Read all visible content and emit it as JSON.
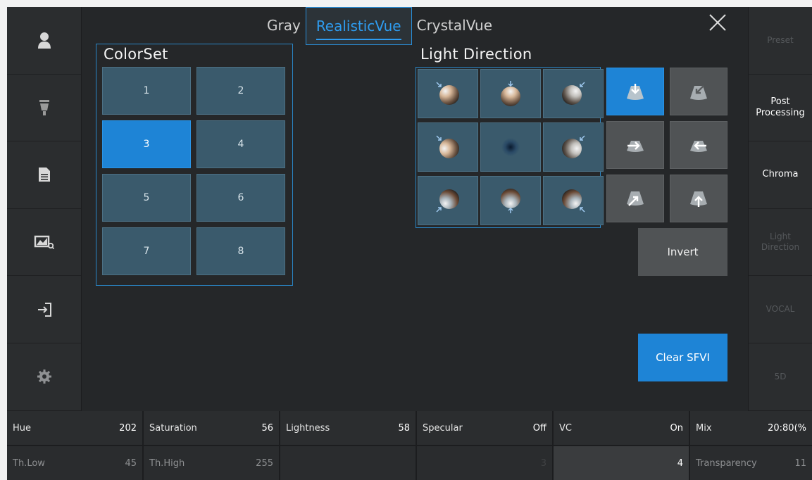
{
  "tabs": [
    {
      "label": "Gray",
      "active": false
    },
    {
      "label": "RealisticVue",
      "active": true
    },
    {
      "label": "CrystalVue",
      "active": false
    }
  ],
  "left_sidebar": [
    "user-icon",
    "probe-icon",
    "report-icon",
    "image-search-icon",
    "exit-icon",
    "gear-icon"
  ],
  "right_sidebar": [
    {
      "label": "Preset",
      "enabled": false
    },
    {
      "label": "Post\nProcessing",
      "enabled": true
    },
    {
      "label": "Chroma",
      "enabled": true
    },
    {
      "label": "Light\nDirection",
      "enabled": false
    },
    {
      "label": "VOCAL",
      "enabled": false
    },
    {
      "label": "5D",
      "enabled": false
    }
  ],
  "colorset": {
    "title": "ColorSet",
    "buttons": [
      "1",
      "2",
      "3",
      "4",
      "5",
      "6",
      "7",
      "8"
    ],
    "selected": "3"
  },
  "light_direction": {
    "title": "Light Direction"
  },
  "actions": {
    "invert": "Invert",
    "clear_sfvi": "Clear SFVI"
  },
  "params_row1": [
    {
      "label": "Hue",
      "value": "202"
    },
    {
      "label": "Saturation",
      "value": "56"
    },
    {
      "label": "Lightness",
      "value": "58"
    },
    {
      "label": "Specular",
      "value": "Off"
    },
    {
      "label": "VC",
      "value": "On"
    },
    {
      "label": "Mix",
      "value": "20:80(%"
    }
  ],
  "params_row2": [
    {
      "label": "Th.Low",
      "value": "45"
    },
    {
      "label": "Th.High",
      "value": "255"
    },
    {
      "label": "",
      "value": ""
    },
    {
      "label": "",
      "value": "3"
    },
    {
      "label": "",
      "value": "4"
    },
    {
      "label": "Transparency",
      "value": "11"
    }
  ],
  "colors": {
    "accent": "#1e84d6",
    "panel_border": "#2a86c6",
    "button_teal": "#3a5a6c",
    "background": "#252729"
  }
}
